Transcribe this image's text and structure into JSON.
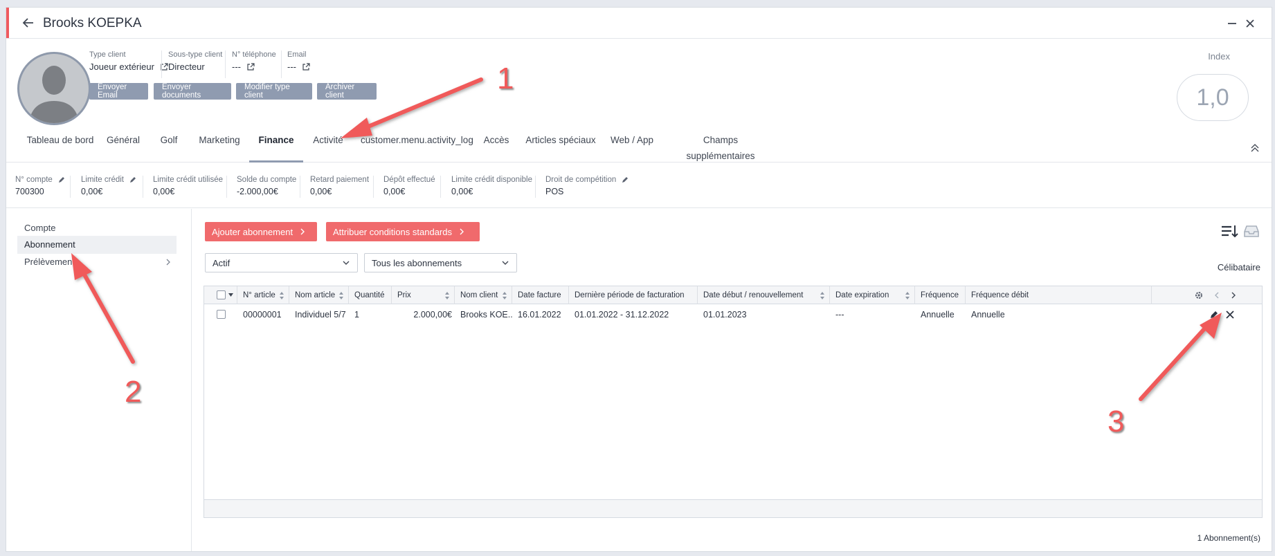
{
  "window": {
    "title": "Brooks KOEPKA"
  },
  "header": {
    "fields": [
      {
        "label": "Type client",
        "value": "Joueur extérieur",
        "link": true
      },
      {
        "label": "Sous-type client",
        "value": "Directeur",
        "link": false
      },
      {
        "label": "N° téléphone",
        "value": "---",
        "link": true
      },
      {
        "label": "Email",
        "value": "---",
        "link": true
      }
    ],
    "buttons": [
      "Envoyer Email",
      "Envoyer documents",
      "Modifier type client",
      "Archiver client"
    ],
    "index_label": "Index",
    "index_value": "1,0"
  },
  "tabs": [
    {
      "label": "Tableau de bord"
    },
    {
      "label": "Général"
    },
    {
      "label": "Golf"
    },
    {
      "label": "Marketing"
    },
    {
      "label": "Finance",
      "active": true
    },
    {
      "label": "Activité"
    },
    {
      "label": "customer.menu.activity_log"
    },
    {
      "label": "Accès"
    },
    {
      "label": "Articles spéciaux"
    },
    {
      "label": "Web / App"
    },
    {
      "label": "Champs supplémentaires"
    }
  ],
  "finance_info": [
    {
      "label": "N° compte",
      "value": "700300",
      "editable": true
    },
    {
      "label": "Limite crédit",
      "value": "0,00€",
      "editable": true
    },
    {
      "label": "Limite crédit utilisée",
      "value": "0,00€"
    },
    {
      "label": "Solde du compte",
      "value": "-2.000,00€"
    },
    {
      "label": "Retard paiement",
      "value": "0,00€"
    },
    {
      "label": "Dépôt effectué",
      "value": "0,00€"
    },
    {
      "label": "Limite crédit disponible",
      "value": "0,00€"
    },
    {
      "label": "Droit de compétition",
      "value": "POS",
      "editable": true
    }
  ],
  "sidebar": {
    "items": [
      {
        "label": "Compte"
      },
      {
        "label": "Abonnement",
        "active": true
      },
      {
        "label": "Prélèvements",
        "has_children": true
      }
    ]
  },
  "actions": {
    "add_subscription": "Ajouter abonnement",
    "assign_conditions": "Attribuer conditions standards"
  },
  "filters": {
    "status": "Actif",
    "type": "Tous les abonnements"
  },
  "status_text": "Célibataire",
  "table": {
    "columns": [
      "N° article",
      "Nom article",
      "Quantité",
      "Prix",
      "Nom client",
      "Date facture",
      "Dernière période de facturation",
      "Date début / renouvellement",
      "Date expiration",
      "Fréquence",
      "Fréquence débit"
    ],
    "rows": [
      {
        "article_no": "00000001",
        "article_name": "Individuel 5/7",
        "quantity": "1",
        "price": "2.000,00€",
        "client_name": "Brooks KOE...",
        "invoice_date": "16.01.2022",
        "last_period": "01.01.2022 - 31.12.2022",
        "start_date": "01.01.2023",
        "expiry_date": "---",
        "frequency": "Annuelle",
        "debit_frequency": "Annuelle"
      }
    ]
  },
  "footer": {
    "count": "1 Abonnement(s)"
  },
  "annotations": [
    "1",
    "2",
    "3"
  ],
  "colors": {
    "accent_red": "#f06a6c",
    "grey_button": "#8f9bb0",
    "annotation": "#f05a5a"
  }
}
